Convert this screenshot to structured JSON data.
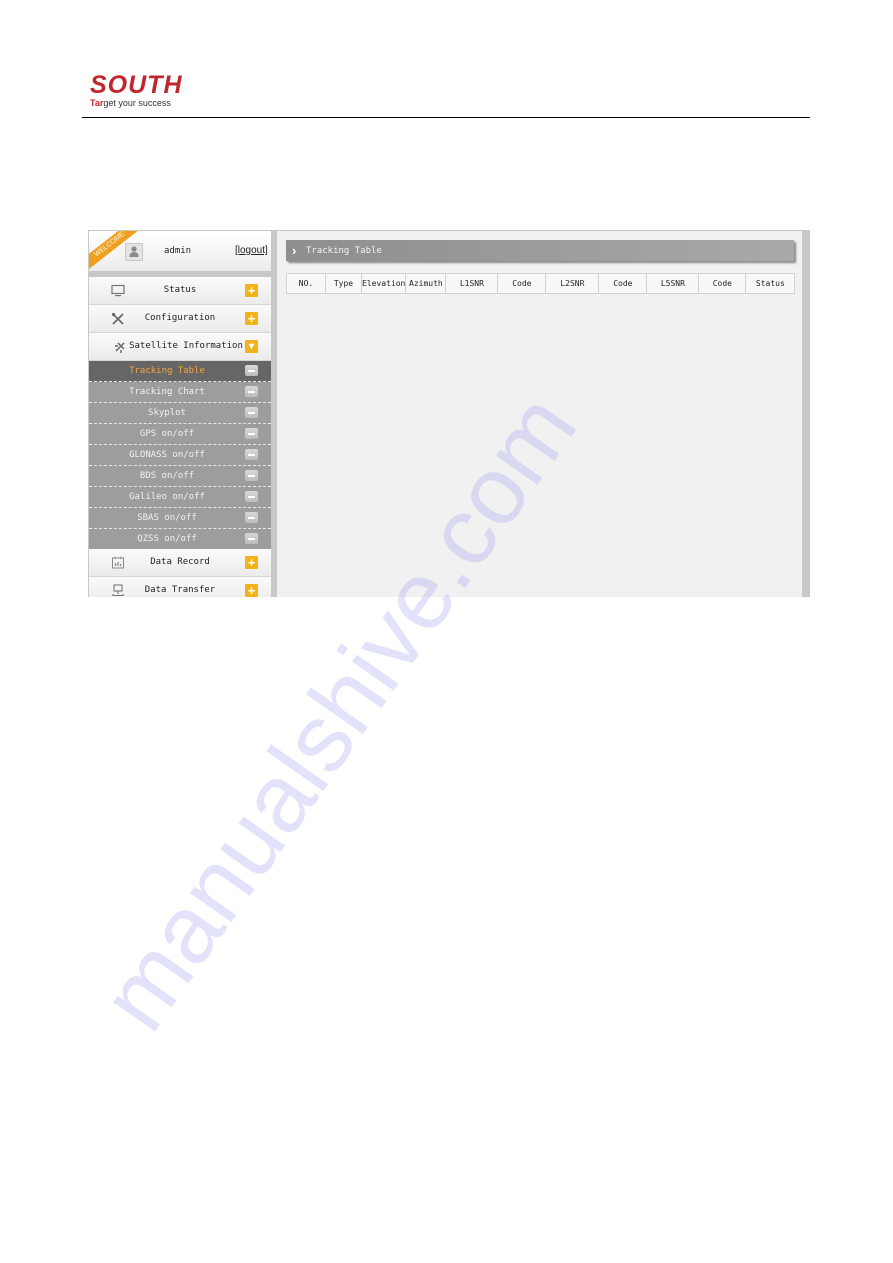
{
  "document_header": {
    "brand": "SOUTH",
    "tagline_prefix": "Tar",
    "tagline_rest": "get your success"
  },
  "sidebar": {
    "welcome_ribbon": "WELCOME",
    "username": "admin",
    "logout_label": "[logout]",
    "menu": [
      {
        "label": "Status",
        "icon": "monitor-icon",
        "expander": "+"
      },
      {
        "label": "Configuration",
        "icon": "tools-icon",
        "expander": "+"
      },
      {
        "label": "Satellite Information",
        "icon": "satellite-icon",
        "expander": "▾"
      }
    ],
    "submenu": [
      {
        "label": "Tracking Table",
        "active": true
      },
      {
        "label": "Tracking Chart"
      },
      {
        "label": "Skyplot"
      },
      {
        "label": "GPS on/off"
      },
      {
        "label": "GLONASS on/off"
      },
      {
        "label": "BDS on/off"
      },
      {
        "label": "Galileo on/off"
      },
      {
        "label": "SBAS on/off"
      },
      {
        "label": "QZSS on/off"
      }
    ],
    "menu_after": [
      {
        "label": "Data Record",
        "icon": "calendar-chart-icon",
        "expander": "+"
      },
      {
        "label": "Data Transfer",
        "icon": "network-icon",
        "expander": "+"
      }
    ]
  },
  "main": {
    "title": "Tracking Table",
    "table": {
      "columns": [
        "NO.",
        "Type",
        "Elevation",
        "Azimuth",
        "L1SNR",
        "Code",
        "L2SNR",
        "Code",
        "L5SNR",
        "Code",
        "Status"
      ],
      "rows": []
    }
  },
  "colors": {
    "brand_red": "#c0272d",
    "accent_orange": "#f2b21c",
    "active_text": "#f4a340"
  },
  "watermark": "manualshive.com"
}
